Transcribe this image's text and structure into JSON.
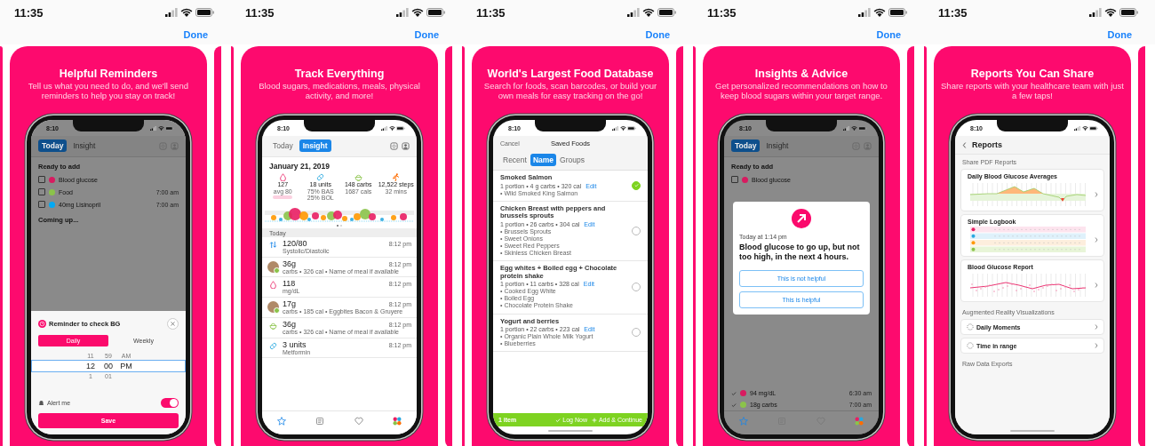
{
  "panels": [
    {
      "status_time": "11:35",
      "done": "Done",
      "title": "Helpful Reminders",
      "subtitle": "Tell us what you need to do, and we'll send reminders to help you stay on track!",
      "screen": {
        "kind": "reminder",
        "time": "8:10",
        "dimmed": true,
        "tabs": [
          {
            "label": "Today",
            "selected": true
          },
          {
            "label": "Insight",
            "selected": false
          }
        ],
        "heading": "Ready to add",
        "items": [
          {
            "label": "Blood glucose",
            "color": "#d81b60",
            "checked": false
          },
          {
            "label": "Food",
            "color": "#8bc34a",
            "checked": false,
            "time": "7:00 am"
          },
          {
            "label": "40mg Lisinopril",
            "color": "#03a9f4",
            "checked": false,
            "time": "7:00 am"
          }
        ],
        "next_heading": "Coming up...",
        "sheet": {
          "title": "Reminder to check BG",
          "segments": [
            {
              "label": "Daily",
              "selected": true
            },
            {
              "label": "Weekly",
              "selected": false
            }
          ],
          "picker": [
            {
              "cells": [
                "11",
                "59",
                "AM"
              ],
              "selected": false
            },
            {
              "cells": [
                "12",
                "00",
                "PM"
              ],
              "selected": true
            },
            {
              "cells": [
                "1",
                "01"
              ],
              "selected": false
            }
          ],
          "alert": {
            "label": "Alert me",
            "on": true
          },
          "save": "Save"
        }
      }
    },
    {
      "status_time": "11:35",
      "done": "Done",
      "title": "Track Everything",
      "subtitle": "Blood sugars, medications, meals, physical activity, and more!",
      "screen": {
        "kind": "insight",
        "time": "8:10",
        "tabs": [
          {
            "label": "Today",
            "selected": false
          },
          {
            "label": "Insight",
            "selected": true
          }
        ],
        "date": "January 21, 2019",
        "stats": [
          {
            "kind": "glucose",
            "lines": [
              "127",
              "avg 80"
            ]
          },
          {
            "kind": "insulin",
            "lines": [
              "18 units",
              "75% BAS",
              "25% BOL"
            ]
          },
          {
            "kind": "food",
            "lines": [
              "148 carbs",
              "1687 cals"
            ]
          },
          {
            "kind": "activity",
            "lines": [
              "12,522 steps",
              "32 mins"
            ]
          }
        ],
        "list_heading": "Today",
        "entries": [
          {
            "kind": "pressure",
            "value": "120/80",
            "detail": "Systolic/Diastolic",
            "time": "8:12 pm"
          },
          {
            "kind": "meal_photo",
            "value": "36g",
            "detail": "carbs • 326 cal • Name of meal if available",
            "time": "8:12 pm"
          },
          {
            "kind": "glucose",
            "value": "118",
            "detail": "mg/dL",
            "time": "8:12 pm"
          },
          {
            "kind": "meal_photo",
            "value": "17g",
            "detail": "carbs • 185 cal • Eggbites Bacon & Gruyere",
            "time": "8:12 pm"
          },
          {
            "kind": "food",
            "value": "36g",
            "detail": "carbs • 326 cal • Name of meal if available",
            "time": "8:12 pm"
          },
          {
            "kind": "insulin",
            "value": "3 units",
            "detail": "Metformin",
            "time": "8:12 pm"
          }
        ]
      }
    },
    {
      "status_time": "11:35",
      "done": "Done",
      "title": "World's Largest Food Database",
      "subtitle": "Search for foods, scan barcodes, or build your own meals for easy tracking on the go!",
      "screen": {
        "kind": "foods",
        "time": "8:10",
        "cancel": "Cancel",
        "nav_title": "Saved Foods",
        "segments": [
          {
            "label": "Recent",
            "selected": false
          },
          {
            "label": "Name",
            "selected": true
          },
          {
            "label": "Groups",
            "selected": false
          }
        ],
        "foods": [
          {
            "name": "Smoked Salmon",
            "info": "1 portion • 4 g carbs • 320 cal",
            "edit": "Edit",
            "ingredients": [
              "• Wild Smoked King Salmon"
            ],
            "selected": true
          },
          {
            "name": "Chicken Breast with peppers and brussels sprouts",
            "info": "1 portion • 26 carbs • 304 cal",
            "edit": "Edit",
            "ingredients": [
              "• Brussels Sprouts",
              "• Sweet Onions",
              "• Sweet Red Peppers",
              "• Skinless Chicken Breast"
            ],
            "selected": false
          },
          {
            "name": "Egg whites + Boiled egg + Chocolate protein shake",
            "info": "1 portion • 11 carbs • 328 cal",
            "edit": "Edit",
            "ingredients": [
              "• Cooked Egg White",
              "• Boiled Egg",
              "• Chocolate Protein Shake"
            ],
            "selected": false
          },
          {
            "name": "Yogurt and berries",
            "info": "1 portion • 22 carbs • 223 cal",
            "edit": "Edit",
            "ingredients": [
              "• Organic Plain Whole Milk Yogurt",
              "• Blueberries"
            ],
            "selected": false
          }
        ],
        "footer": {
          "count": "1 item",
          "actions": [
            "Log Now",
            "Add & Continue"
          ]
        }
      }
    },
    {
      "status_time": "11:35",
      "done": "Done",
      "title": "Insights & Advice",
      "subtitle": "Get personalized recommendations on how to keep blood sugars within your target range.",
      "screen": {
        "kind": "advice",
        "time": "8:10",
        "dimmed": true,
        "tabs": [
          {
            "label": "Today",
            "selected": true
          },
          {
            "label": "Insight",
            "selected": false
          }
        ],
        "heading": "Ready to add",
        "items": [
          {
            "label": "Blood glucose",
            "color": "#d81b60",
            "checked": false
          }
        ],
        "dialog": {
          "time": "Today at 1:14 pm",
          "message": "Blood glucose to go up, but not too high, in the next 4 hours.",
          "buttons": [
            "This is not helpful",
            "This is helpful"
          ]
        },
        "done_items": [
          {
            "label": "94 mg/dL",
            "color": "#d81b60",
            "time": "6:30 am"
          },
          {
            "label": "18g carbs",
            "color": "#8bc34a",
            "time": "7:00 am"
          }
        ]
      }
    },
    {
      "status_time": "11:35",
      "done": "Done",
      "title": "Reports You Can Share",
      "subtitle": "Share reports with your healthcare team with just a few taps!",
      "screen": {
        "kind": "reports",
        "time": "8:10",
        "nav_title": "Reports",
        "pdf_heading": "Share PDF Reports",
        "reports": [
          {
            "title": "Daily Blood Glucose Averages",
            "kind": "averages"
          },
          {
            "title": "Simple Logbook",
            "kind": "logbook"
          },
          {
            "title": "Blood Glucose Report",
            "kind": "scatter"
          }
        ],
        "ar_heading": "Augmented Reality Visualizations",
        "links": [
          "Daily Moments",
          "Time in range"
        ],
        "raw_heading": "Raw Data Exports"
      }
    }
  ]
}
